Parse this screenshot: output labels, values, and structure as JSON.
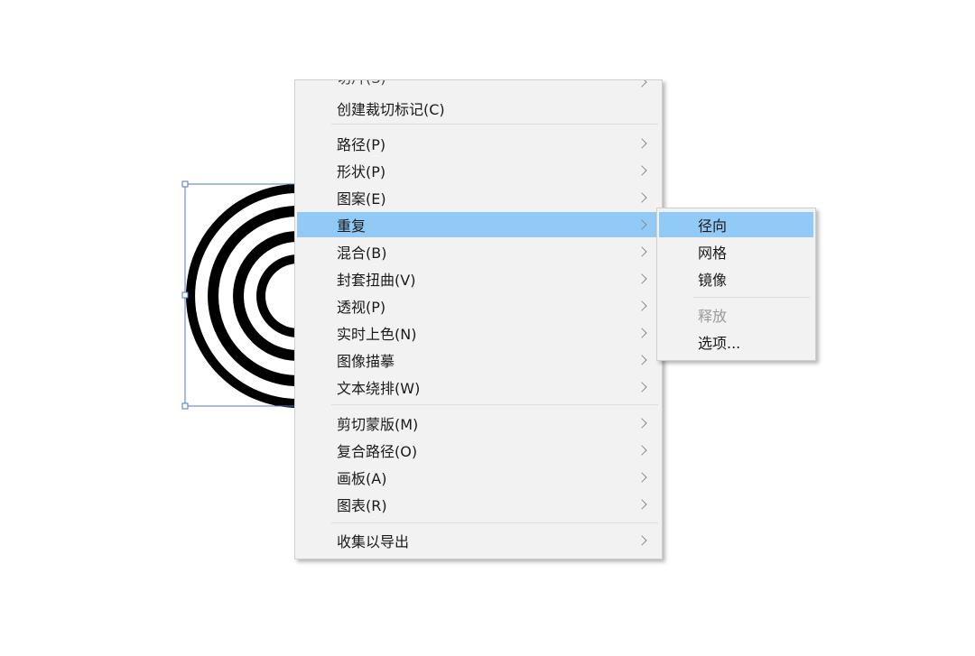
{
  "canvas": {
    "selection_color": "#4a78c8",
    "shape_color": "#000000"
  },
  "context_menu": {
    "items": [
      {
        "label": "切片(S)",
        "has_submenu": true
      },
      {
        "label": "创建裁切标记(C)",
        "has_submenu": false
      },
      {
        "label": "路径(P)",
        "has_submenu": true
      },
      {
        "label": "形状(P)",
        "has_submenu": true
      },
      {
        "label": "图案(E)",
        "has_submenu": true
      },
      {
        "label": "重复",
        "has_submenu": true,
        "highlighted": true
      },
      {
        "label": "混合(B)",
        "has_submenu": true
      },
      {
        "label": "封套扭曲(V)",
        "has_submenu": true
      },
      {
        "label": "透视(P)",
        "has_submenu": true
      },
      {
        "label": "实时上色(N)",
        "has_submenu": true
      },
      {
        "label": "图像描摹",
        "has_submenu": true
      },
      {
        "label": "文本绕排(W)",
        "has_submenu": true
      },
      {
        "label": "剪切蒙版(M)",
        "has_submenu": true
      },
      {
        "label": "复合路径(O)",
        "has_submenu": true
      },
      {
        "label": "画板(A)",
        "has_submenu": true
      },
      {
        "label": "图表(R)",
        "has_submenu": true
      },
      {
        "label": "收集以导出",
        "has_submenu": true
      }
    ],
    "highlight_color": "#91c9f7"
  },
  "submenu": {
    "items": [
      {
        "label": "径向",
        "highlighted": true
      },
      {
        "label": "网格"
      },
      {
        "label": "镜像"
      },
      {
        "label": "释放",
        "disabled": true
      },
      {
        "label": "选项..."
      }
    ]
  }
}
